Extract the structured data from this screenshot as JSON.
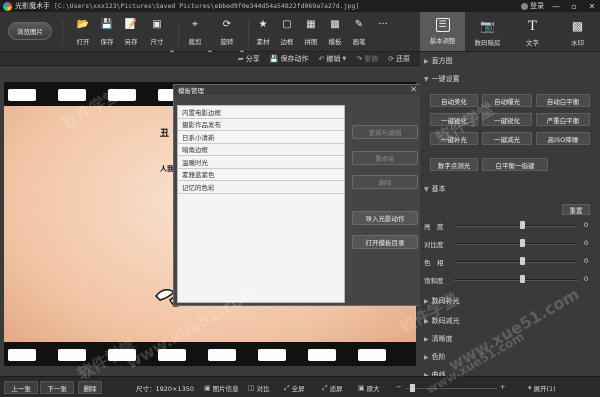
{
  "titlebar": {
    "app_name": "光影魔术手",
    "file_path": "[C:\\Users\\xxx123\\Pictures\\Saved Pictures\\ebbed9f0e344d54a54822fd069a7a27d.jpg]",
    "login": "登录",
    "min": "—",
    "restore": "▫",
    "close": "✕"
  },
  "toolbar": {
    "browse": "浏览图片",
    "items": [
      {
        "label": "打开",
        "icon": "folder-icon"
      },
      {
        "label": "保存",
        "icon": "save-icon"
      },
      {
        "label": "另存",
        "icon": "save-as-icon"
      },
      {
        "label": "尺寸",
        "icon": "resize-icon"
      },
      {
        "label": "裁剪",
        "icon": "crop-icon"
      },
      {
        "label": "旋转",
        "icon": "rotate-icon"
      },
      {
        "label": "素材",
        "icon": "material-icon"
      },
      {
        "label": "边框",
        "icon": "frame-icon"
      },
      {
        "label": "拼图",
        "icon": "collage-icon"
      },
      {
        "label": "模板",
        "icon": "template-icon"
      },
      {
        "label": "画笔",
        "icon": "brush-icon"
      },
      {
        "label": "···",
        "icon": "more-icon"
      }
    ]
  },
  "right_tabs": [
    {
      "label": "基本调整",
      "icon": "adjust-icon",
      "active": true
    },
    {
      "label": "数码暗房",
      "icon": "camera-icon",
      "active": false
    },
    {
      "label": "文字",
      "icon": "text-icon",
      "active": false
    },
    {
      "label": "水印",
      "icon": "watermark-icon",
      "active": false
    }
  ],
  "subbar": {
    "share": "分享",
    "save_action": "保存动作",
    "undo": "撤销",
    "redo": "重做",
    "restore": "还原"
  },
  "photo": {
    "heading": "丑",
    "subtext": "人我"
  },
  "dialog": {
    "title": "模板管理",
    "close": "✕",
    "items": [
      "内置电影边框",
      "摄影作品发布",
      "日系小清新",
      "暗角边框",
      "温暖时光",
      "素雅蓝紫色",
      "记忆的色彩"
    ],
    "buttons": [
      {
        "label": "更新与编辑",
        "disabled": true
      },
      {
        "label": "重命名",
        "disabled": true
      },
      {
        "label": "删除",
        "disabled": true
      },
      {
        "label": "导入光影动作",
        "disabled": false
      },
      {
        "label": "打开模板目录",
        "disabled": false
      }
    ]
  },
  "rpanel": {
    "histogram": "直方图",
    "quick_adjust": "一键设置",
    "quick_buttons": [
      "自动美化",
      "自动曝光",
      "自动白平衡",
      "一键锐化",
      "一键锐化",
      "严重白平衡",
      "一键补光",
      "一键减光",
      "高ISO降噪",
      "高ISO降噪",
      "数字点测光",
      "白平衡一指键"
    ],
    "basic": "基本",
    "reset": "重置",
    "sliders": [
      {
        "label": "亮　度",
        "value": "0",
        "level": 0.55
      },
      {
        "label": "对比度",
        "value": "0",
        "level": 0.55
      },
      {
        "label": "色　相",
        "value": "0",
        "level": 0.55
      },
      {
        "label": "饱和度",
        "value": "0",
        "level": 0.55
      }
    ],
    "sections": [
      "数码补光",
      "数码减光",
      "清晰度",
      "色阶",
      "曲线"
    ]
  },
  "statusbar": {
    "prev": "上一张",
    "next": "下一张",
    "delete": "删除",
    "size": "尺寸：1920×1350",
    "info": "图片信息",
    "compare": "对比",
    "fullscreen": "全屏",
    "fit": "适屏",
    "original": "原大",
    "zoom_level": 0.05,
    "expand": "展开(1)"
  },
  "watermark": {
    "texts": [
      "软件学堂",
      "软件学堂",
      "www.xue51.com",
      "软件学堂",
      "www.xue51.com",
      "软件学堂",
      "www.xue51.com"
    ]
  }
}
